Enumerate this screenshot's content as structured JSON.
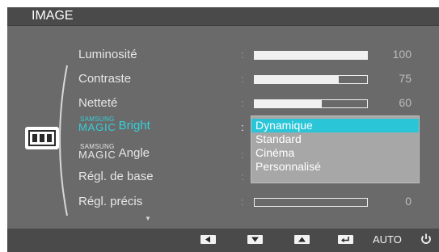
{
  "title": "IMAGE",
  "menu": [
    {
      "label": "Luminosité",
      "bar": 1.0,
      "value": "100"
    },
    {
      "label": "Contraste",
      "bar": 0.75,
      "value": "75"
    },
    {
      "label": "Netteté",
      "bar": 0.6,
      "value": "60"
    },
    {
      "brand_small": "SAMSUNG",
      "brand_big": "MAGIC",
      "label": "Bright",
      "active": true
    },
    {
      "brand_small": "SAMSUNG",
      "brand_big": "MAGIC",
      "label": "Angle"
    },
    {
      "label": "Régl. de base"
    },
    {
      "label": "Régl. précis",
      "bar": 0.0,
      "value": "0"
    }
  ],
  "dropdown": {
    "options": [
      "Dynamique",
      "Standard",
      "Cinéma",
      "Personnalisé"
    ],
    "selected_index": 0
  },
  "bottom_bar": {
    "keys": [
      "left-arrow-key",
      "down-arrow-key",
      "up-arrow-key",
      "enter-key"
    ],
    "auto_label": "AUTO",
    "power_icon": "power-icon"
  },
  "colors": {
    "accent": "#2ac6d8",
    "active_text": "#33d0dc",
    "panel": "#6a6a6a",
    "bar_strip": "#4a4a4a"
  }
}
